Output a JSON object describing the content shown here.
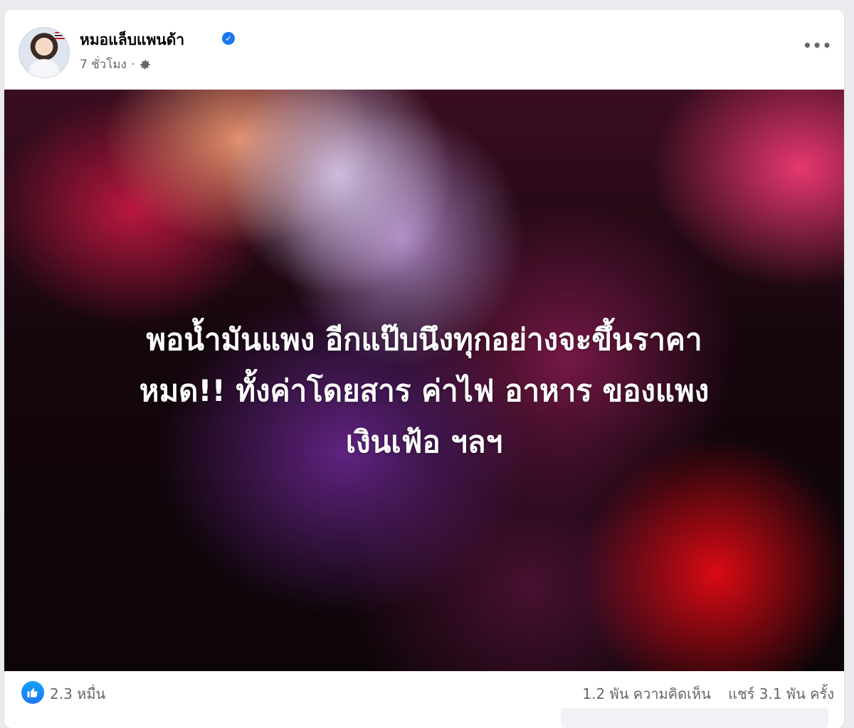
{
  "post": {
    "author_name": "หมอแล็บแพนด้า",
    "timestamp": "7 ชั่วโมง",
    "meta_separator": "·",
    "verified_icon": "verified-badge-icon",
    "privacy_icon": "gear-icon",
    "more_label": "•••"
  },
  "image": {
    "text_lines": [
      "พอน้ำมันแพง อีกแป๊บนึงทุกอย่างจะขึ้นราคา",
      "หมด!! ทั้งค่าโดยสาร ค่าไฟ อาหาร ของแพง",
      "เงินเฟ้อ ฯลฯ"
    ]
  },
  "reactions": {
    "like_icon": "like-icon",
    "like_count": "2.3 หมื่น",
    "comments": "1.2 พัน ความคิดเห็น",
    "shares": "แชร์ 3.1 พัน ครั้ง"
  },
  "colors": {
    "accent": "#1877f2",
    "text_primary": "#050505",
    "text_secondary": "#65676b"
  }
}
